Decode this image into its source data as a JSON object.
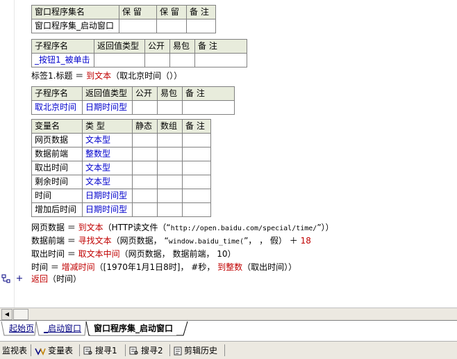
{
  "table_assembly": {
    "headers": [
      "窗口程序集名",
      "保 留",
      "保 留",
      "备 注"
    ],
    "row": [
      "窗口程序集_启动窗口",
      "",
      "",
      ""
    ]
  },
  "table_sub1": {
    "headers": [
      "子程序名",
      "返回值类型",
      "公开",
      "易包",
      "备 注"
    ],
    "row": [
      "_按钮1_被单击",
      "",
      "",
      "",
      ""
    ]
  },
  "line_label": {
    "target": "标签1.标题",
    "op": "＝",
    "func": "到文本",
    "args": "（取北京时间（））"
  },
  "table_sub2": {
    "headers": [
      "子程序名",
      "返回值类型",
      "公开",
      "易包",
      "备 注"
    ],
    "row": [
      "取北京时间",
      "日期时间型",
      "",
      "",
      ""
    ]
  },
  "table_vars": {
    "headers": [
      "变量名",
      "类 型",
      "静态",
      "数组",
      "备 注"
    ],
    "rows": [
      [
        "网页数据",
        "文本型"
      ],
      [
        "数据前端",
        "整数型"
      ],
      [
        "取出时间",
        "文本型"
      ],
      [
        "剩余时间",
        "文本型"
      ],
      [
        "时间",
        "日期时间型"
      ],
      [
        "增加后时间",
        "日期时间型"
      ]
    ]
  },
  "code": {
    "l1": {
      "a": "网页数据 ＝ ",
      "f": "到文本",
      "b": "（HTTP读文件（“",
      "s": "http://open.baidu.com/special/time/",
      "c": "”））"
    },
    "l2": {
      "a": "数据前端 ＝ ",
      "f": "寻找文本",
      "b": "（网页数据， “",
      "s": "window.baidu_time(",
      "c": "”， ， 假） ＋ ",
      "n": "18"
    },
    "l3": {
      "a": "取出时间 ＝ ",
      "f": "取文本中间",
      "b": "（网页数据， 数据前端， 10）"
    },
    "l4": {
      "a": "时间 ＝ ",
      "f": "增减时间",
      "b": "（[1970年1月1日8时]， #秒， ",
      "f2": "到整数",
      "c": "（取出时间））"
    },
    "l5": {
      "f": "返回",
      "b": "（时间）"
    }
  },
  "tabs": [
    "起始页",
    "_启动窗口",
    "窗口程序集_启动窗口"
  ],
  "bottom": [
    "监视表",
    "变量表",
    "搜寻1",
    "搜寻2",
    "剪辑历史"
  ],
  "colors": {
    "keyword": "#0000cc",
    "func": "#c00000",
    "header_bg": "#e8ecdc"
  }
}
